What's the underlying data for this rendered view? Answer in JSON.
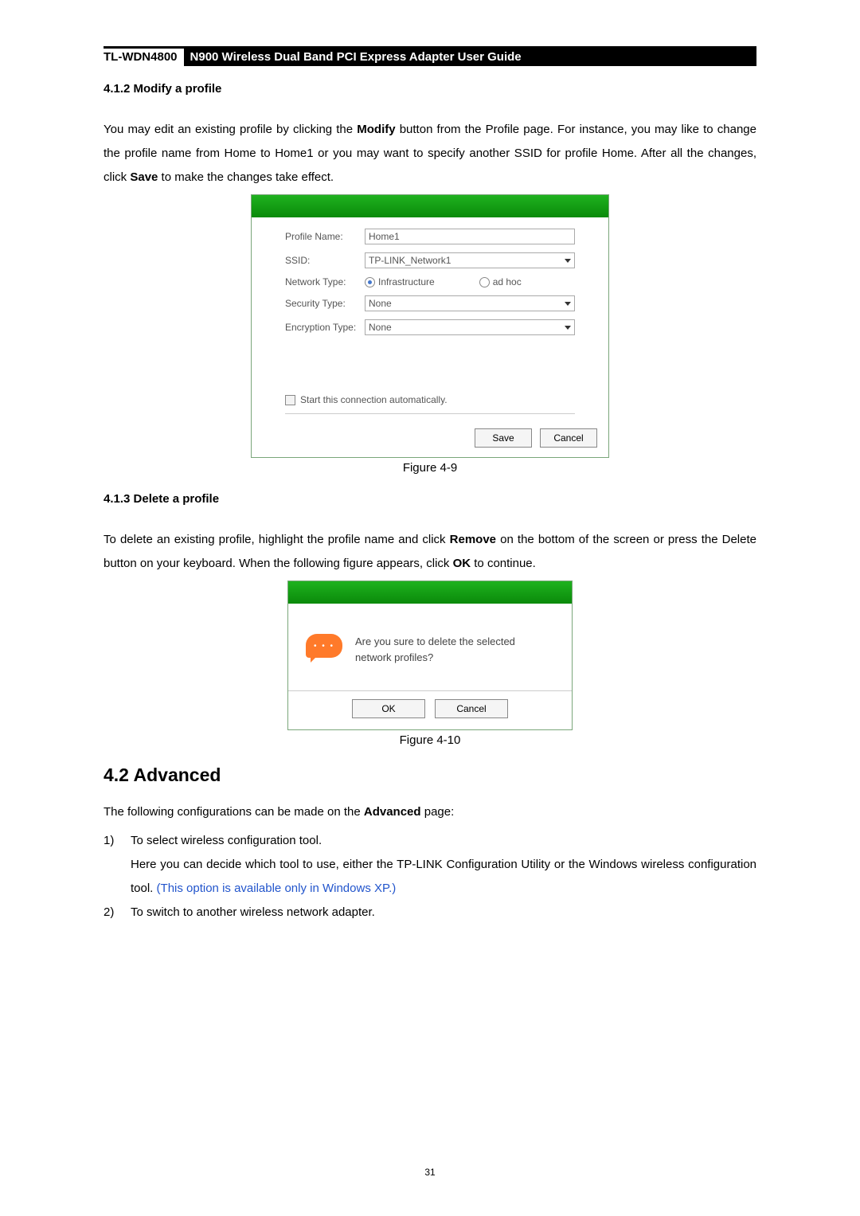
{
  "header": {
    "model": "TL-WDN4800",
    "title": "N900 Wireless Dual Band PCI Express Adapter User Guide"
  },
  "sec412": {
    "heading": "4.1.2  Modify a profile",
    "p1a": "You may edit an existing profile by clicking the ",
    "p1b_bold": "Modify",
    "p1c": " button from the Profile page. For instance, you may like to change the profile name from Home to Home1 or you may want to specify another SSID for profile Home. After all the changes, click ",
    "p1d_bold": "Save",
    "p1e": " to make the changes take effect."
  },
  "dlg1": {
    "labels": {
      "profile_name": "Profile Name:",
      "ssid": "SSID:",
      "network_type": "Network Type:",
      "security_type": "Security Type:",
      "encryption_type": "Encryption Type:"
    },
    "values": {
      "profile_name": "Home1",
      "ssid": "TP-LINK_Network1",
      "security_type": "None",
      "encryption_type": "None"
    },
    "radios": {
      "infra": "Infrastructure",
      "adhoc": "ad hoc"
    },
    "checkbox": "Start this connection automatically.",
    "buttons": {
      "save": "Save",
      "cancel": "Cancel"
    },
    "caption": "Figure 4-9"
  },
  "sec413": {
    "heading": "4.1.3  Delete a profile",
    "p1a": "To delete an existing profile, highlight the profile name and click ",
    "p1b_bold": "Remove",
    "p1c": " on the bottom of the screen or press the Delete button on your keyboard. When the following figure appears, click ",
    "p1d_bold": "OK",
    "p1e": " to continue."
  },
  "dlg2": {
    "bubble": "•  •  •",
    "msg": "Are you sure to delete the selected network profiles?",
    "ok": "OK",
    "cancel": "Cancel",
    "caption": "Figure 4-10"
  },
  "sec42": {
    "heading": "4.2  Advanced",
    "intro_a": "The following configurations can be made on the ",
    "intro_b_bold": "Advanced",
    "intro_c": " page:",
    "items": [
      {
        "num": "1)",
        "lines": [
          "To select wireless configuration tool.",
          "Here you can decide which tool to use, either the TP-LINK Configuration Utility or the Windows wireless configuration tool.   "
        ],
        "note": "(This option is available only in Windows XP.)"
      },
      {
        "num": "2)",
        "lines": [
          "To switch to another wireless network adapter."
        ],
        "note": ""
      }
    ]
  },
  "page_number": "31"
}
